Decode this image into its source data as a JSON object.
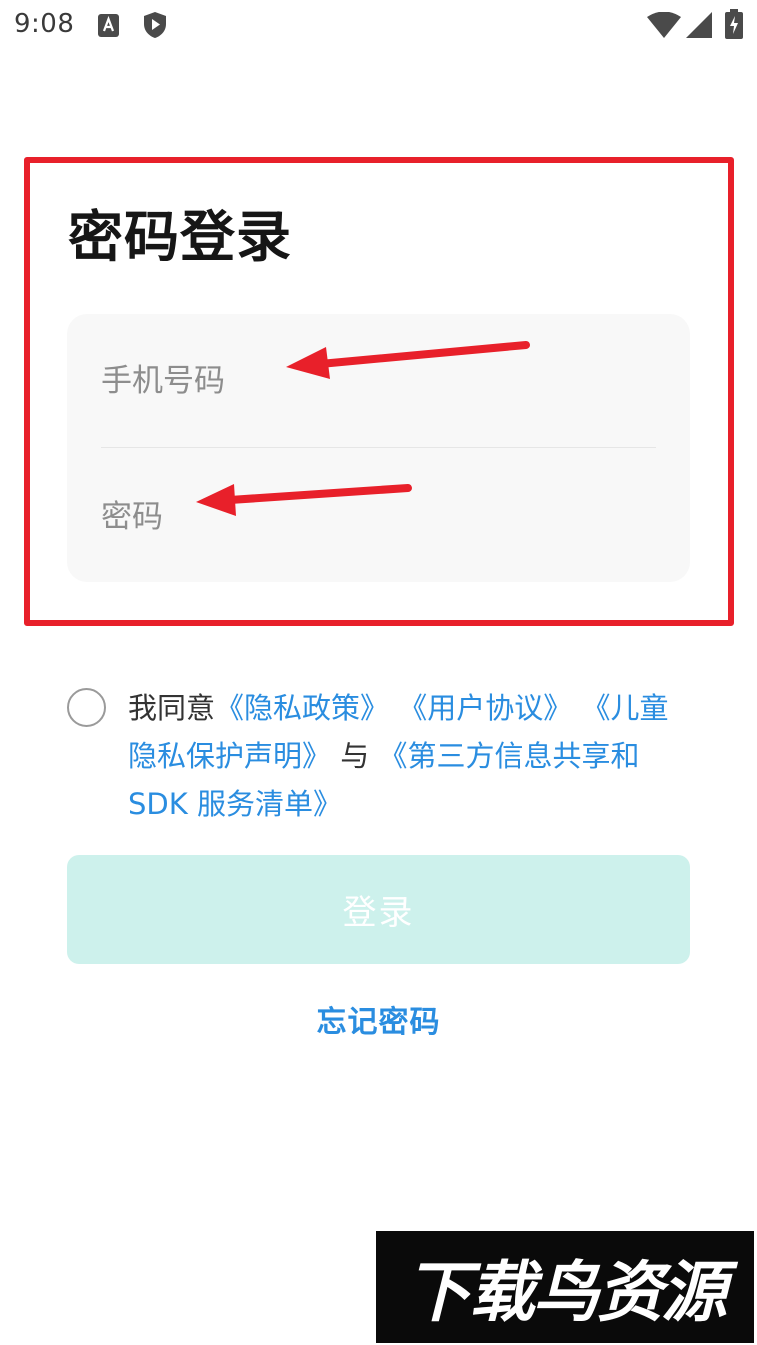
{
  "status_bar": {
    "time": "9:08",
    "icons": [
      "app-a-icon",
      "shield-icon",
      "wifi-icon",
      "signal-icon",
      "battery-charging-icon"
    ]
  },
  "login": {
    "title": "密码登录",
    "phone_placeholder": "手机号码",
    "password_placeholder": "密码",
    "button_label": "登录",
    "forgot_label": "忘记密码"
  },
  "agreement": {
    "prefix": "我同意",
    "link_privacy": "《隐私政策》",
    "link_user": "《用户协议》",
    "link_child": "《儿童隐私保护声明》",
    "conjunction": "与",
    "link_sdk": "《第三方信息共享和SDK 服务清单》"
  },
  "annotation": {
    "frame_color": "#e8202a",
    "arrow_color": "#e8202a"
  },
  "watermark": {
    "text": "下载鸟资源"
  },
  "colors": {
    "accent": "#2a8de0",
    "button_disabled": "#cdf1ec",
    "card_background": "#f8f8f8"
  }
}
